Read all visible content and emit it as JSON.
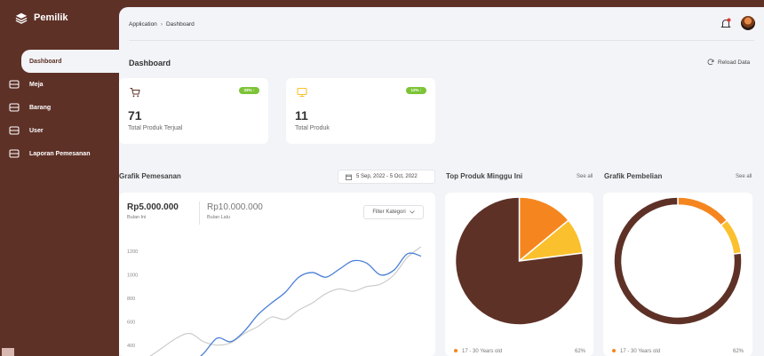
{
  "app": {
    "title": "Pemilik"
  },
  "colors": {
    "brown": "#5e3127",
    "orange": "#f5861f",
    "yellow": "#fbc02d",
    "blue": "#4a7fd6",
    "grey_line": "#c8c8c8",
    "green_badge": "#7cc436"
  },
  "sidebar": {
    "items": [
      {
        "label": "Dashboard",
        "icon": "home-icon",
        "active": true
      },
      {
        "label": "Meja",
        "icon": "box-icon",
        "active": false
      },
      {
        "label": "Barang",
        "icon": "box-icon",
        "active": false
      },
      {
        "label": "User",
        "icon": "box-icon",
        "active": false
      },
      {
        "label": "Laporan Pemesanan",
        "icon": "box-icon",
        "active": false
      }
    ]
  },
  "breadcrumb": {
    "root": "Application",
    "separator": "›",
    "current": "Dashboard"
  },
  "page": {
    "title": "Dashboard",
    "reload_label": "Reload Data"
  },
  "stats": [
    {
      "value": "71",
      "label": "Total Produk Terjual",
      "badge": "33% ↑",
      "icon": "cart-icon"
    },
    {
      "value": "11",
      "label": "Total Produk",
      "badge": "12% ↑",
      "icon": "monitor-icon"
    }
  ],
  "grafik_pemesanan": {
    "title": "Grafik Pemesanan",
    "date_range": "5 Sep, 2022 - 5 Oct, 2022",
    "current_value": "Rp5.000.000",
    "current_label": "Bulan Ini",
    "previous_value": "Rp10.000.000",
    "previous_label": "Bulan Lalu",
    "filter_label": "Filter Kategori"
  },
  "top_produk": {
    "title": "Top Produk Minggu Ini",
    "see_all": "See all",
    "legend_label": "17 - 30 Years old",
    "legend_value": "62%"
  },
  "grafik_pembelian": {
    "title": "Grafik Pembelian",
    "see_all": "See all",
    "legend_label": "17 - 30 Years old",
    "legend_value": "62%"
  },
  "chart_data": [
    {
      "type": "line",
      "yticks": [
        "1200",
        "1000",
        "800",
        "600",
        "400"
      ],
      "ylim": [
        300,
        1300
      ],
      "x": [
        0,
        1,
        2,
        3,
        4,
        5,
        6,
        7,
        8,
        9,
        10,
        11,
        12,
        13,
        14,
        15,
        16,
        17,
        18,
        19,
        20
      ],
      "series": [
        {
          "values": [
            250,
            270,
            260,
            240,
            330,
            460,
            430,
            520,
            660,
            760,
            850,
            980,
            1020,
            980,
            1050,
            1120,
            1100,
            1000,
            1040,
            1180,
            1160
          ]
        },
        {
          "values": [
            300,
            380,
            460,
            500,
            430,
            400,
            420,
            500,
            560,
            640,
            620,
            700,
            760,
            840,
            880,
            860,
            900,
            920,
            1000,
            1150,
            1240
          ]
        }
      ]
    },
    {
      "type": "pie",
      "values": [
        0.77,
        0.14,
        0.09
      ],
      "colors": [
        "#5e3127",
        "#f5861f",
        "#fbc02d"
      ]
    },
    {
      "type": "pie",
      "values": [
        0.77,
        0.14,
        0.09
      ],
      "colors": [
        "#5e3127",
        "#f5861f",
        "#fbc02d"
      ]
    }
  ]
}
